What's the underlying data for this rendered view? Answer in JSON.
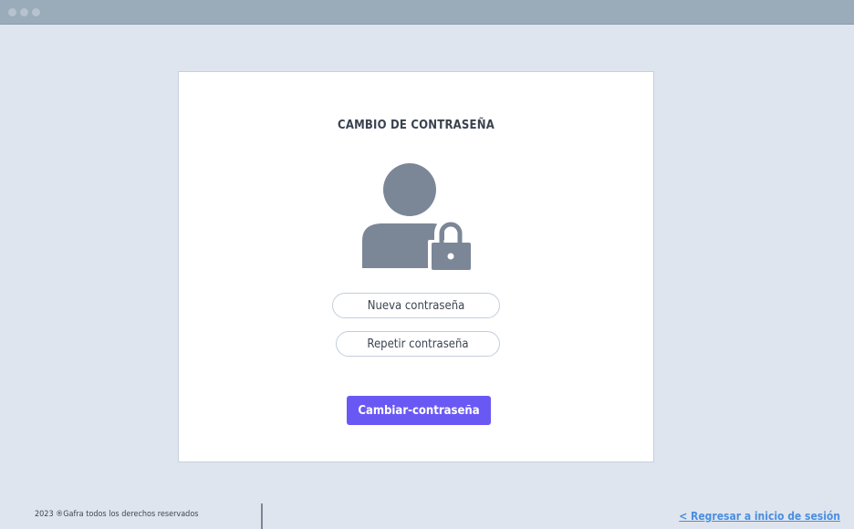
{
  "window": {
    "controls": [
      "dot",
      "dot",
      "dot"
    ]
  },
  "card": {
    "title": "CAMBIO DE CONTRASEÑA",
    "icon": "user-lock-icon",
    "new_password": {
      "placeholder": "Nueva contraseña",
      "value": ""
    },
    "repeat_password": {
      "placeholder": "Repetir contraseña",
      "value": ""
    },
    "submit_label": "Cambiar-contraseña"
  },
  "footer": {
    "copyright": "2023 ®Gafra todos los derechos reservados",
    "back_link": "< Regresar a inicio de sesión"
  },
  "colors": {
    "background": "#dfe5ee",
    "titlebar": "#9aabba",
    "icon": "#7b8797",
    "primary_button": "#6a58f5",
    "link": "#4a8fe0"
  }
}
